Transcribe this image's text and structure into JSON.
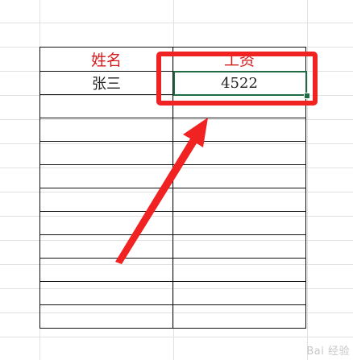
{
  "table": {
    "headers": [
      "姓名",
      "工资"
    ],
    "rows": [
      [
        "张三",
        "4522"
      ]
    ],
    "empty_rows": 10
  },
  "colors": {
    "header_text": "#d41c1c",
    "highlight": "#f02222",
    "selection": "#1f6b43",
    "grid": "#e1e1e1"
  },
  "watermark": "Bai 经验"
}
